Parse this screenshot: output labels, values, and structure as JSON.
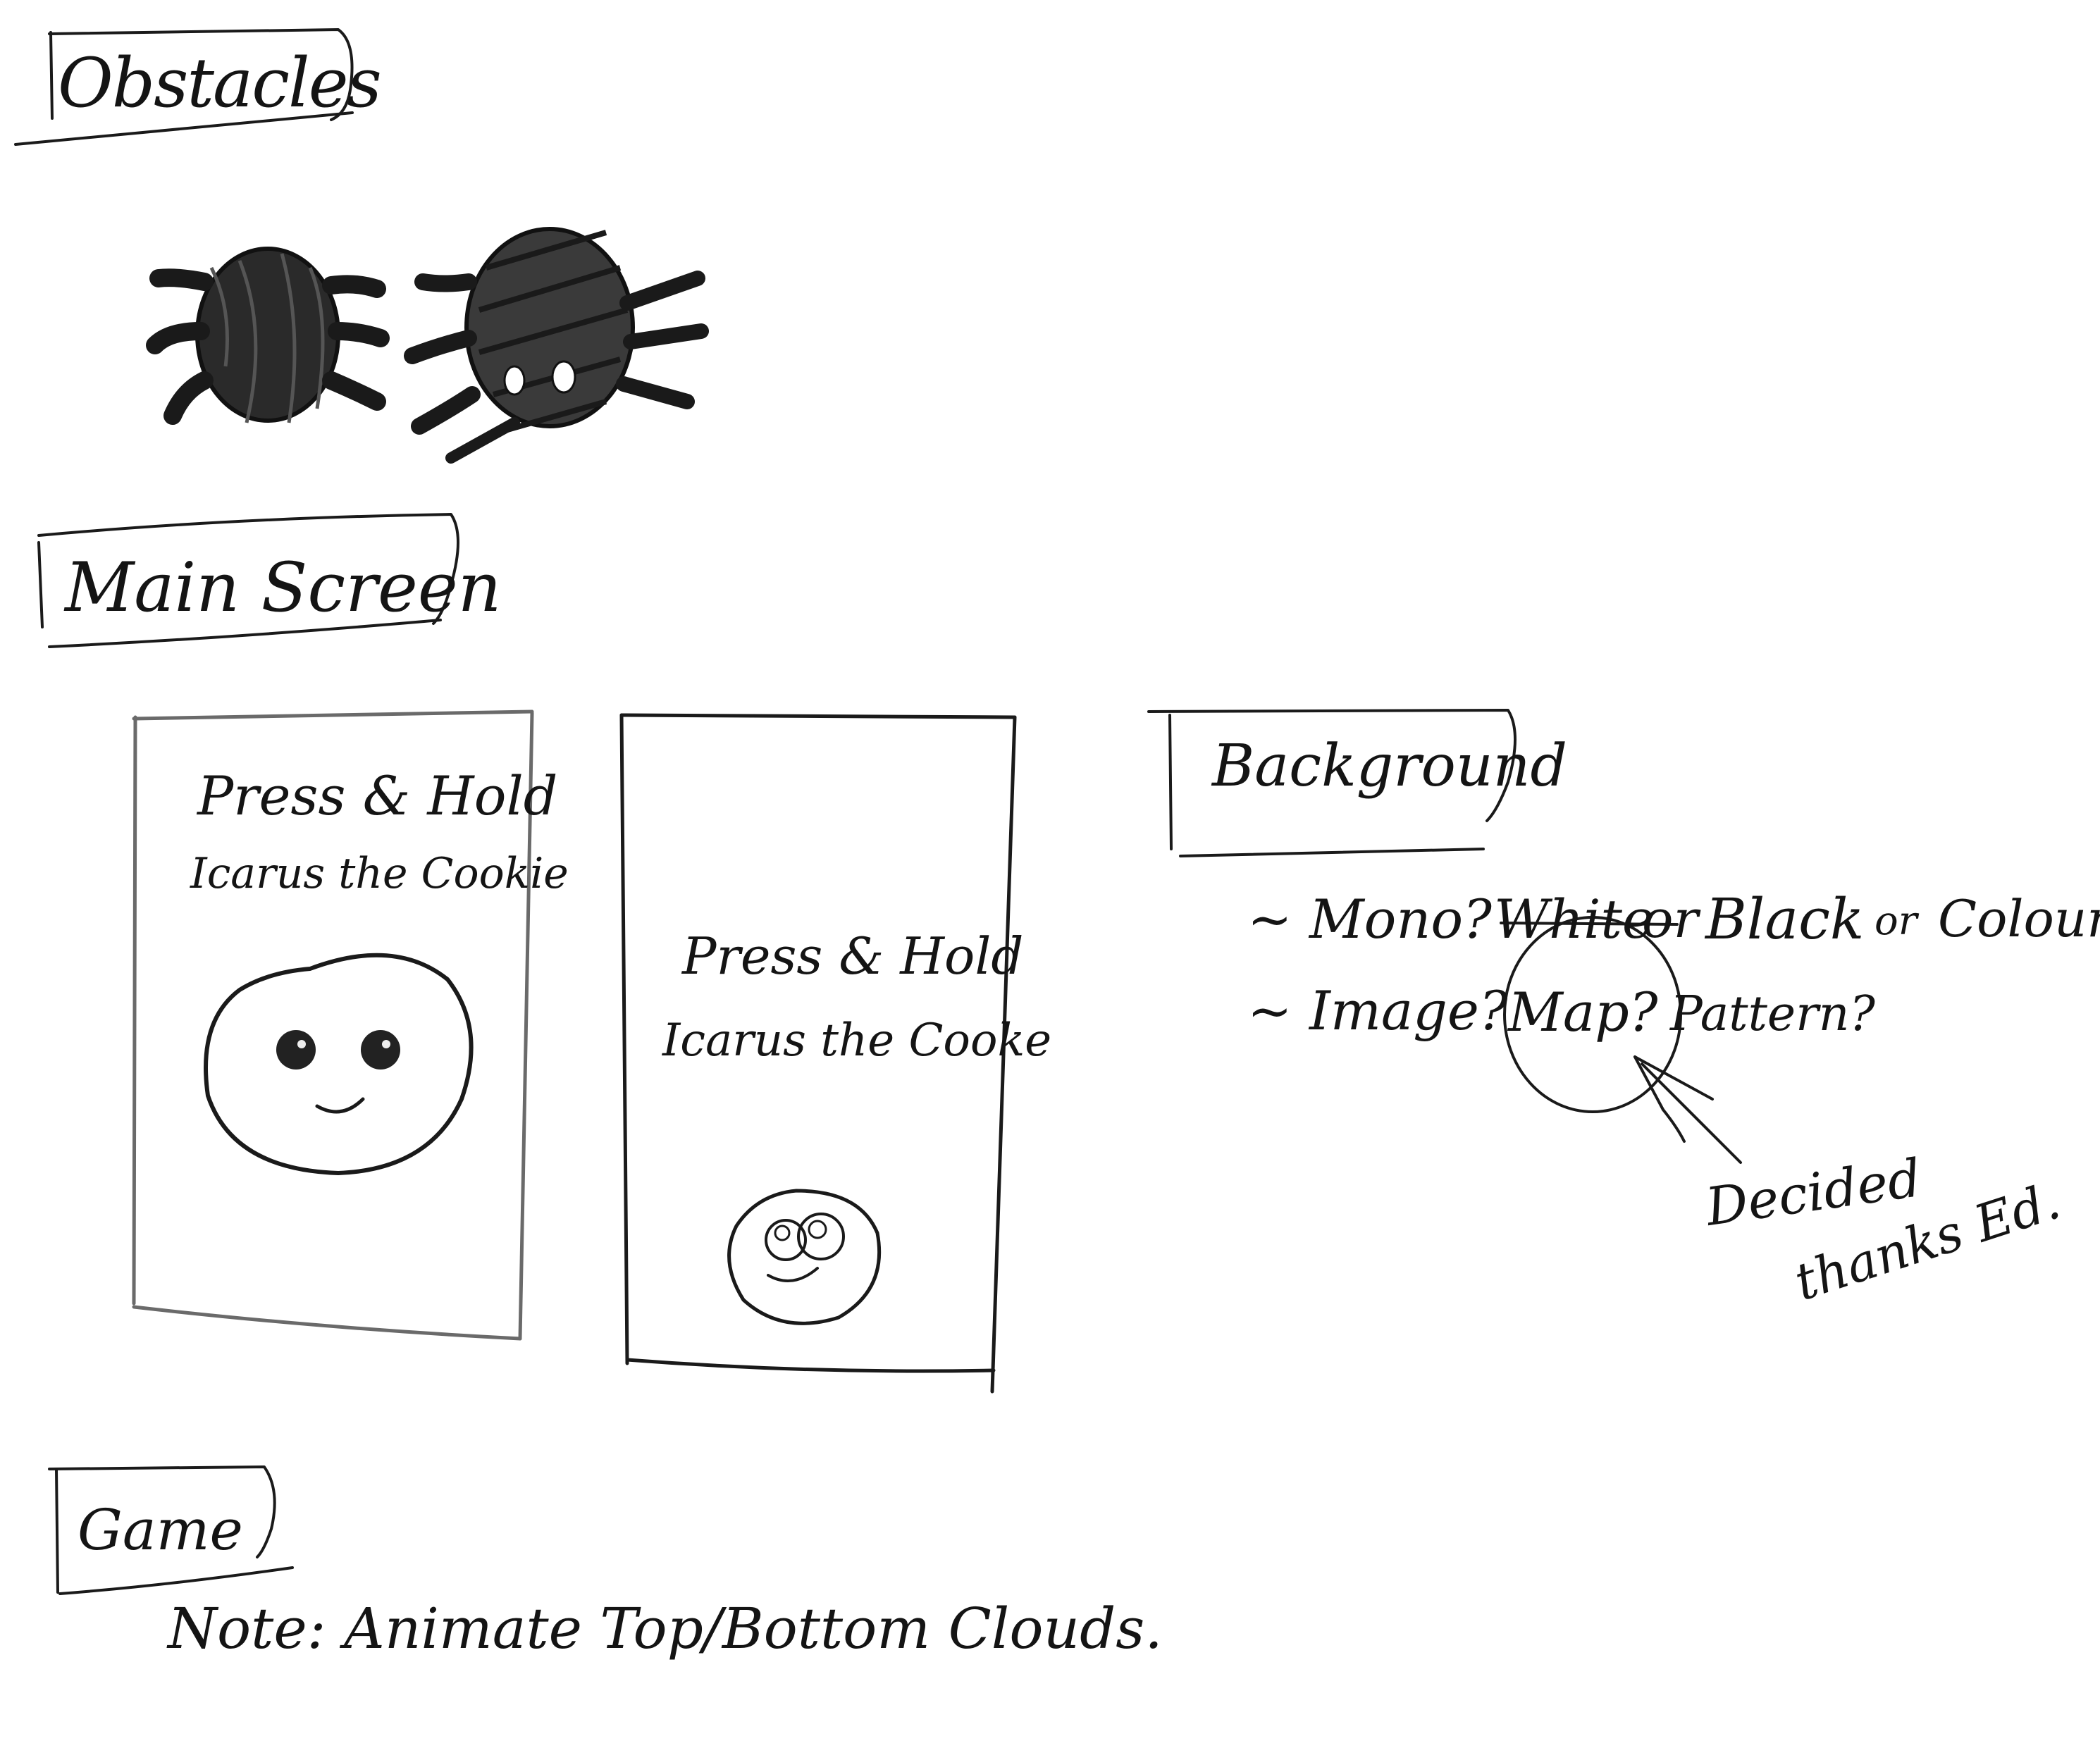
{
  "sections": {
    "obstacles": {
      "label": "Obstacles"
    },
    "main_screen": {
      "label": "Main Screen"
    },
    "game": {
      "label": "Game",
      "note": "Note: Animate Top/Bottom Clouds."
    }
  },
  "mockups": [
    {
      "line1": "Press & Hold",
      "line2": "Icarus the Cookie"
    },
    {
      "line1": "Press & Hold",
      "line2": "Icarus the Cooke"
    }
  ],
  "background": {
    "label": "Background",
    "option_mono": "~ Mono?",
    "option_white": "White",
    "option_or1": "or",
    "option_black": "Black",
    "option_or2": "or",
    "option_colour": "Colour.",
    "option_image": "~ Image?",
    "option_map": "Map?",
    "option_pattern": "Pattern?",
    "decision_line1": "Decided",
    "decision_line2": "thanks Ed."
  },
  "icons": {
    "obstacle_1": "spider-icon",
    "obstacle_2": "spider-icon",
    "cookie_large": "cookie-face-icon",
    "cookie_small": "cookie-face-icon"
  }
}
